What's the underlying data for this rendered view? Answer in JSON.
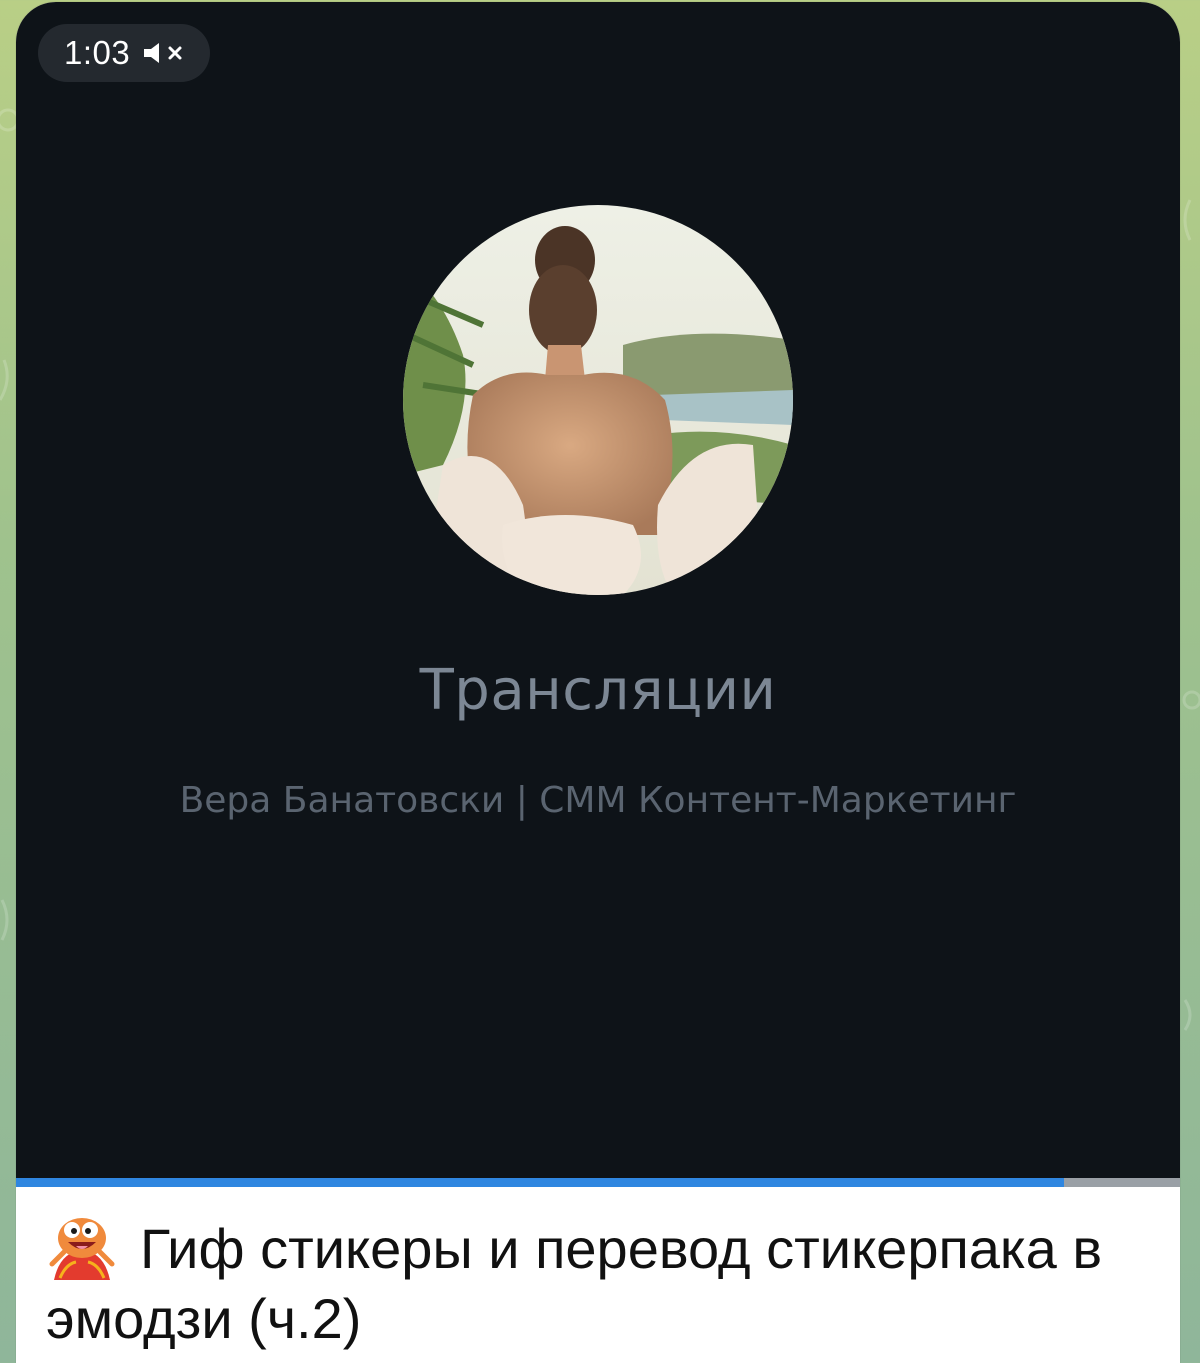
{
  "video": {
    "duration_label": "1:03",
    "mute_icon": "speaker-muted-icon",
    "progress": 0.9
  },
  "channel": {
    "title": "Трансляции",
    "subtitle": "Вера Банатовски | СММ Контент-Маркетинг"
  },
  "caption": {
    "emoji_icon": "dancing-sticker-emoji-icon",
    "text": "Гиф стикеры и перевод стикерпака в эмодзи (ч.2)"
  },
  "colors": {
    "video_background": "#0e1318",
    "progress_fill": "#2f86e0",
    "progress_track": "#9aa0a6",
    "wallpaper": "#a8c68c"
  }
}
